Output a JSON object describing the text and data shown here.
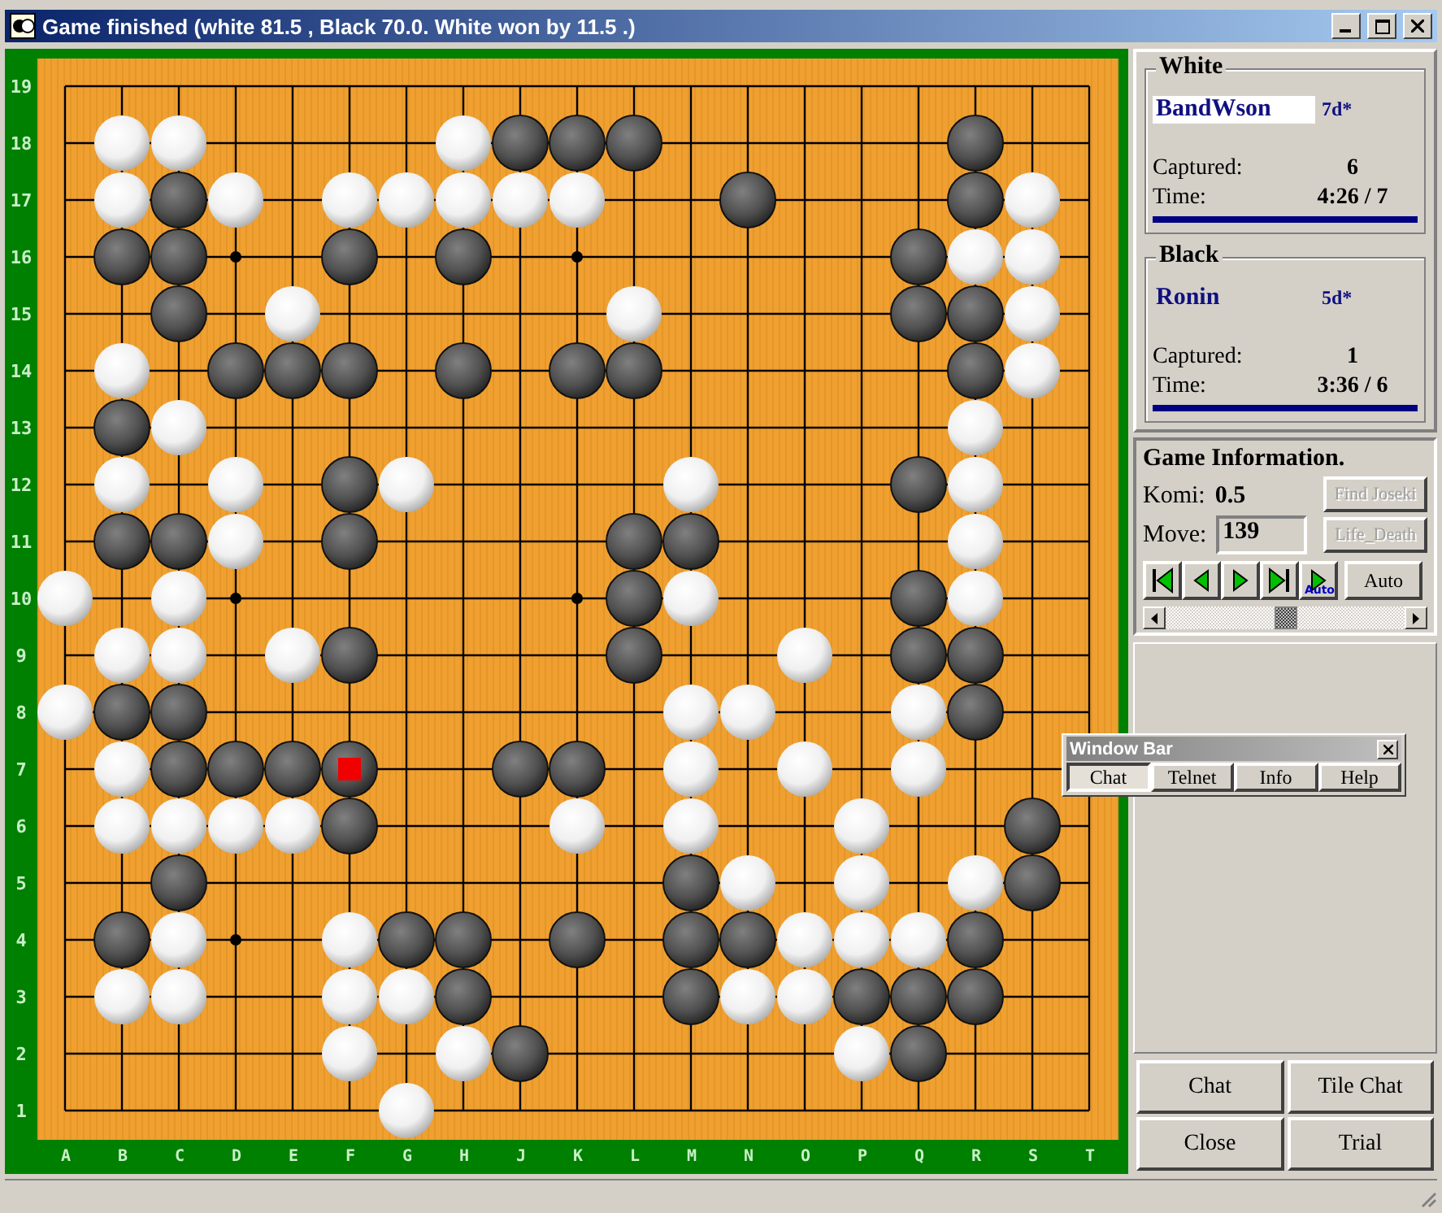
{
  "window": {
    "title": "Game finished (white 81.5 , Black 70.0. White won by 11.5 .)"
  },
  "board": {
    "column_labels": [
      "A",
      "B",
      "C",
      "D",
      "E",
      "F",
      "G",
      "H",
      "J",
      "K",
      "L",
      "M",
      "N",
      "O",
      "P",
      "Q",
      "R",
      "S",
      "T"
    ],
    "rows": [
      {
        "label": "19",
        "points": [
          {
            "kind": "empty"
          },
          {
            "kind": "empty"
          },
          {
            "kind": "empty"
          },
          {
            "kind": "empty"
          },
          {
            "kind": "empty"
          },
          {
            "kind": "empty"
          },
          {
            "kind": "empty"
          },
          {
            "kind": "empty"
          },
          {
            "kind": "empty"
          },
          {
            "kind": "empty"
          },
          {
            "kind": "empty"
          },
          {
            "kind": "empty"
          },
          {
            "kind": "empty"
          },
          {
            "kind": "empty"
          },
          {
            "kind": "empty"
          },
          {
            "kind": "empty"
          },
          {
            "kind": "empty"
          },
          {
            "kind": "empty"
          },
          {
            "kind": "empty"
          }
        ]
      },
      {
        "label": "18",
        "points": [
          {
            "kind": "empty"
          },
          {
            "kind": "white"
          },
          {
            "kind": "white"
          },
          {
            "kind": "empty"
          },
          {
            "kind": "empty"
          },
          {
            "kind": "empty"
          },
          {
            "kind": "empty"
          },
          {
            "kind": "white"
          },
          {
            "kind": "black"
          },
          {
            "kind": "black"
          },
          {
            "kind": "black"
          },
          {
            "kind": "empty"
          },
          {
            "kind": "empty"
          },
          {
            "kind": "empty"
          },
          {
            "kind": "empty"
          },
          {
            "kind": "empty"
          },
          {
            "kind": "black"
          },
          {
            "kind": "empty"
          },
          {
            "kind": "empty"
          }
        ]
      },
      {
        "label": "17",
        "points": [
          {
            "kind": "empty"
          },
          {
            "kind": "white"
          },
          {
            "kind": "black"
          },
          {
            "kind": "white"
          },
          {
            "kind": "empty"
          },
          {
            "kind": "white"
          },
          {
            "kind": "white"
          },
          {
            "kind": "white"
          },
          {
            "kind": "white"
          },
          {
            "kind": "white"
          },
          {
            "kind": "empty"
          },
          {
            "kind": "empty"
          },
          {
            "kind": "black"
          },
          {
            "kind": "empty"
          },
          {
            "kind": "empty"
          },
          {
            "kind": "empty"
          },
          {
            "kind": "black"
          },
          {
            "kind": "white"
          },
          {
            "kind": "empty"
          }
        ]
      },
      {
        "label": "16",
        "points": [
          {
            "kind": "empty"
          },
          {
            "kind": "black"
          },
          {
            "kind": "black"
          },
          {
            "kind": "empty"
          },
          {
            "kind": "empty"
          },
          {
            "kind": "black"
          },
          {
            "kind": "empty"
          },
          {
            "kind": "black"
          },
          {
            "kind": "empty"
          },
          {
            "kind": "empty"
          },
          {
            "kind": "empty"
          },
          {
            "kind": "empty"
          },
          {
            "kind": "empty"
          },
          {
            "kind": "empty"
          },
          {
            "kind": "empty"
          },
          {
            "kind": "black"
          },
          {
            "kind": "white"
          },
          {
            "kind": "white"
          },
          {
            "kind": "empty"
          }
        ]
      },
      {
        "label": "15",
        "points": [
          {
            "kind": "empty"
          },
          {
            "kind": "empty"
          },
          {
            "kind": "black"
          },
          {
            "kind": "empty"
          },
          {
            "kind": "white"
          },
          {
            "kind": "empty"
          },
          {
            "kind": "empty"
          },
          {
            "kind": "empty"
          },
          {
            "kind": "empty"
          },
          {
            "kind": "empty"
          },
          {
            "kind": "white"
          },
          {
            "kind": "empty"
          },
          {
            "kind": "empty"
          },
          {
            "kind": "empty"
          },
          {
            "kind": "empty"
          },
          {
            "kind": "black"
          },
          {
            "kind": "black"
          },
          {
            "kind": "white"
          },
          {
            "kind": "empty"
          }
        ]
      },
      {
        "label": "14",
        "points": [
          {
            "kind": "empty"
          },
          {
            "kind": "white"
          },
          {
            "kind": "empty"
          },
          {
            "kind": "black"
          },
          {
            "kind": "black"
          },
          {
            "kind": "black"
          },
          {
            "kind": "empty"
          },
          {
            "kind": "black"
          },
          {
            "kind": "empty"
          },
          {
            "kind": "black"
          },
          {
            "kind": "black"
          },
          {
            "kind": "empty"
          },
          {
            "kind": "empty"
          },
          {
            "kind": "empty"
          },
          {
            "kind": "empty"
          },
          {
            "kind": "empty"
          },
          {
            "kind": "black"
          },
          {
            "kind": "white"
          },
          {
            "kind": "empty"
          }
        ]
      },
      {
        "label": "13",
        "points": [
          {
            "kind": "empty"
          },
          {
            "kind": "black"
          },
          {
            "kind": "white"
          },
          {
            "kind": "empty"
          },
          {
            "kind": "empty"
          },
          {
            "kind": "empty"
          },
          {
            "kind": "empty"
          },
          {
            "kind": "empty"
          },
          {
            "kind": "empty"
          },
          {
            "kind": "empty"
          },
          {
            "kind": "empty"
          },
          {
            "kind": "empty"
          },
          {
            "kind": "empty"
          },
          {
            "kind": "empty"
          },
          {
            "kind": "empty"
          },
          {
            "kind": "empty"
          },
          {
            "kind": "white"
          },
          {
            "kind": "empty"
          },
          {
            "kind": "empty"
          }
        ]
      },
      {
        "label": "12",
        "points": [
          {
            "kind": "empty"
          },
          {
            "kind": "white"
          },
          {
            "kind": "empty"
          },
          {
            "kind": "white"
          },
          {
            "kind": "empty"
          },
          {
            "kind": "black"
          },
          {
            "kind": "white"
          },
          {
            "kind": "empty"
          },
          {
            "kind": "empty"
          },
          {
            "kind": "empty"
          },
          {
            "kind": "empty"
          },
          {
            "kind": "white"
          },
          {
            "kind": "empty"
          },
          {
            "kind": "empty"
          },
          {
            "kind": "empty"
          },
          {
            "kind": "black"
          },
          {
            "kind": "white"
          },
          {
            "kind": "empty"
          },
          {
            "kind": "empty"
          }
        ]
      },
      {
        "label": "11",
        "points": [
          {
            "kind": "empty"
          },
          {
            "kind": "black"
          },
          {
            "kind": "black"
          },
          {
            "kind": "white"
          },
          {
            "kind": "empty"
          },
          {
            "kind": "black"
          },
          {
            "kind": "empty"
          },
          {
            "kind": "empty"
          },
          {
            "kind": "empty"
          },
          {
            "kind": "empty"
          },
          {
            "kind": "black"
          },
          {
            "kind": "black"
          },
          {
            "kind": "empty"
          },
          {
            "kind": "empty"
          },
          {
            "kind": "empty"
          },
          {
            "kind": "empty"
          },
          {
            "kind": "white"
          },
          {
            "kind": "empty"
          },
          {
            "kind": "empty"
          }
        ]
      },
      {
        "label": "10",
        "points": [
          {
            "kind": "white"
          },
          {
            "kind": "empty"
          },
          {
            "kind": "white"
          },
          {
            "kind": "empty"
          },
          {
            "kind": "empty"
          },
          {
            "kind": "empty"
          },
          {
            "kind": "empty"
          },
          {
            "kind": "empty"
          },
          {
            "kind": "empty"
          },
          {
            "kind": "empty"
          },
          {
            "kind": "black"
          },
          {
            "kind": "white"
          },
          {
            "kind": "empty"
          },
          {
            "kind": "empty"
          },
          {
            "kind": "empty"
          },
          {
            "kind": "black"
          },
          {
            "kind": "white"
          },
          {
            "kind": "empty"
          },
          {
            "kind": "empty"
          }
        ]
      },
      {
        "label": "9",
        "points": [
          {
            "kind": "empty"
          },
          {
            "kind": "white"
          },
          {
            "kind": "white"
          },
          {
            "kind": "empty"
          },
          {
            "kind": "white"
          },
          {
            "kind": "black"
          },
          {
            "kind": "empty"
          },
          {
            "kind": "empty"
          },
          {
            "kind": "empty"
          },
          {
            "kind": "empty"
          },
          {
            "kind": "black"
          },
          {
            "kind": "empty"
          },
          {
            "kind": "empty"
          },
          {
            "kind": "white"
          },
          {
            "kind": "empty"
          },
          {
            "kind": "black"
          },
          {
            "kind": "black"
          },
          {
            "kind": "empty"
          },
          {
            "kind": "empty"
          }
        ]
      },
      {
        "label": "8",
        "points": [
          {
            "kind": "white"
          },
          {
            "kind": "black"
          },
          {
            "kind": "black"
          },
          {
            "kind": "empty"
          },
          {
            "kind": "empty"
          },
          {
            "kind": "empty"
          },
          {
            "kind": "empty"
          },
          {
            "kind": "empty"
          },
          {
            "kind": "empty"
          },
          {
            "kind": "empty"
          },
          {
            "kind": "empty"
          },
          {
            "kind": "white"
          },
          {
            "kind": "white"
          },
          {
            "kind": "empty"
          },
          {
            "kind": "empty"
          },
          {
            "kind": "white"
          },
          {
            "kind": "black"
          },
          {
            "kind": "empty"
          },
          {
            "kind": "empty"
          }
        ]
      },
      {
        "label": "7",
        "points": [
          {
            "kind": "empty"
          },
          {
            "kind": "white"
          },
          {
            "kind": "black"
          },
          {
            "kind": "black"
          },
          {
            "kind": "black"
          },
          {
            "kind": "last"
          },
          {
            "kind": "empty"
          },
          {
            "kind": "empty"
          },
          {
            "kind": "black"
          },
          {
            "kind": "black"
          },
          {
            "kind": "empty"
          },
          {
            "kind": "white"
          },
          {
            "kind": "empty"
          },
          {
            "kind": "white"
          },
          {
            "kind": "empty"
          },
          {
            "kind": "white"
          },
          {
            "kind": "empty"
          },
          {
            "kind": "empty"
          },
          {
            "kind": "empty"
          }
        ]
      },
      {
        "label": "6",
        "points": [
          {
            "kind": "empty"
          },
          {
            "kind": "white"
          },
          {
            "kind": "white"
          },
          {
            "kind": "white"
          },
          {
            "kind": "white"
          },
          {
            "kind": "black"
          },
          {
            "kind": "empty"
          },
          {
            "kind": "empty"
          },
          {
            "kind": "empty"
          },
          {
            "kind": "white"
          },
          {
            "kind": "empty"
          },
          {
            "kind": "white"
          },
          {
            "kind": "empty"
          },
          {
            "kind": "empty"
          },
          {
            "kind": "white"
          },
          {
            "kind": "empty"
          },
          {
            "kind": "empty"
          },
          {
            "kind": "black"
          },
          {
            "kind": "empty"
          }
        ]
      },
      {
        "label": "5",
        "points": [
          {
            "kind": "empty"
          },
          {
            "kind": "empty"
          },
          {
            "kind": "black"
          },
          {
            "kind": "empty"
          },
          {
            "kind": "empty"
          },
          {
            "kind": "empty"
          },
          {
            "kind": "empty"
          },
          {
            "kind": "empty"
          },
          {
            "kind": "empty"
          },
          {
            "kind": "empty"
          },
          {
            "kind": "empty"
          },
          {
            "kind": "black"
          },
          {
            "kind": "white"
          },
          {
            "kind": "empty"
          },
          {
            "kind": "white"
          },
          {
            "kind": "empty"
          },
          {
            "kind": "white"
          },
          {
            "kind": "black"
          },
          {
            "kind": "empty"
          }
        ]
      },
      {
        "label": "4",
        "points": [
          {
            "kind": "empty"
          },
          {
            "kind": "black"
          },
          {
            "kind": "white"
          },
          {
            "kind": "empty"
          },
          {
            "kind": "empty"
          },
          {
            "kind": "white"
          },
          {
            "kind": "black"
          },
          {
            "kind": "black"
          },
          {
            "kind": "empty"
          },
          {
            "kind": "black"
          },
          {
            "kind": "empty"
          },
          {
            "kind": "black"
          },
          {
            "kind": "black"
          },
          {
            "kind": "white"
          },
          {
            "kind": "white"
          },
          {
            "kind": "white"
          },
          {
            "kind": "black"
          },
          {
            "kind": "empty"
          },
          {
            "kind": "empty"
          }
        ]
      },
      {
        "label": "3",
        "points": [
          {
            "kind": "empty"
          },
          {
            "kind": "white"
          },
          {
            "kind": "white"
          },
          {
            "kind": "empty"
          },
          {
            "kind": "empty"
          },
          {
            "kind": "white"
          },
          {
            "kind": "white"
          },
          {
            "kind": "black"
          },
          {
            "kind": "empty"
          },
          {
            "kind": "empty"
          },
          {
            "kind": "empty"
          },
          {
            "kind": "black"
          },
          {
            "kind": "white"
          },
          {
            "kind": "white"
          },
          {
            "kind": "black"
          },
          {
            "kind": "black"
          },
          {
            "kind": "black"
          },
          {
            "kind": "empty"
          },
          {
            "kind": "empty"
          }
        ]
      },
      {
        "label": "2",
        "points": [
          {
            "kind": "empty"
          },
          {
            "kind": "empty"
          },
          {
            "kind": "empty"
          },
          {
            "kind": "empty"
          },
          {
            "kind": "empty"
          },
          {
            "kind": "white"
          },
          {
            "kind": "empty"
          },
          {
            "kind": "white"
          },
          {
            "kind": "black"
          },
          {
            "kind": "empty"
          },
          {
            "kind": "empty"
          },
          {
            "kind": "empty"
          },
          {
            "kind": "empty"
          },
          {
            "kind": "empty"
          },
          {
            "kind": "white"
          },
          {
            "kind": "black"
          },
          {
            "kind": "empty"
          },
          {
            "kind": "empty"
          },
          {
            "kind": "empty"
          }
        ]
      },
      {
        "label": "1",
        "points": [
          {
            "kind": "empty"
          },
          {
            "kind": "empty"
          },
          {
            "kind": "empty"
          },
          {
            "kind": "empty"
          },
          {
            "kind": "empty"
          },
          {
            "kind": "empty"
          },
          {
            "kind": "white"
          },
          {
            "kind": "empty"
          },
          {
            "kind": "empty"
          },
          {
            "kind": "empty"
          },
          {
            "kind": "empty"
          },
          {
            "kind": "empty"
          },
          {
            "kind": "empty"
          },
          {
            "kind": "empty"
          },
          {
            "kind": "empty"
          },
          {
            "kind": "empty"
          },
          {
            "kind": "empty"
          },
          {
            "kind": "empty"
          },
          {
            "kind": "empty"
          }
        ]
      }
    ]
  },
  "players": [
    {
      "heading": "White",
      "name": "BandWson",
      "rank": "7d*",
      "highlighted": true,
      "captured_label": "Captured:",
      "captured": "6",
      "time_label": "Time:",
      "time": "4:26 / 7"
    },
    {
      "heading": "Black",
      "name": "Ronin",
      "rank": "5d*",
      "highlighted": false,
      "captured_label": "Captured:",
      "captured": "1",
      "time_label": "Time:",
      "time": "3:36 / 6"
    }
  ],
  "game_info": {
    "heading": "Game Information.",
    "komi_label": "Komi:",
    "komi": "0.5",
    "move_label": "Move:",
    "move": "139",
    "side_buttons": [
      {
        "label": "Find Joseki",
        "disabled": true
      },
      {
        "label": "Life_Death",
        "disabled": true
      }
    ],
    "nav_buttons": [
      {
        "kind": "first"
      },
      {
        "kind": "prev"
      },
      {
        "kind": "next"
      },
      {
        "kind": "last"
      },
      {
        "kind": "autoplay",
        "label": "Auto"
      }
    ],
    "auto_button": "Auto"
  },
  "window_bar": {
    "title": "Window Bar",
    "tabs": [
      {
        "label": "Chat",
        "selected": true
      },
      {
        "label": "Telnet",
        "selected": false
      },
      {
        "label": "Info",
        "selected": false
      },
      {
        "label": "Help",
        "selected": false
      }
    ]
  },
  "buttons": [
    "Chat",
    "Tile Chat",
    "Close",
    "Trial"
  ]
}
